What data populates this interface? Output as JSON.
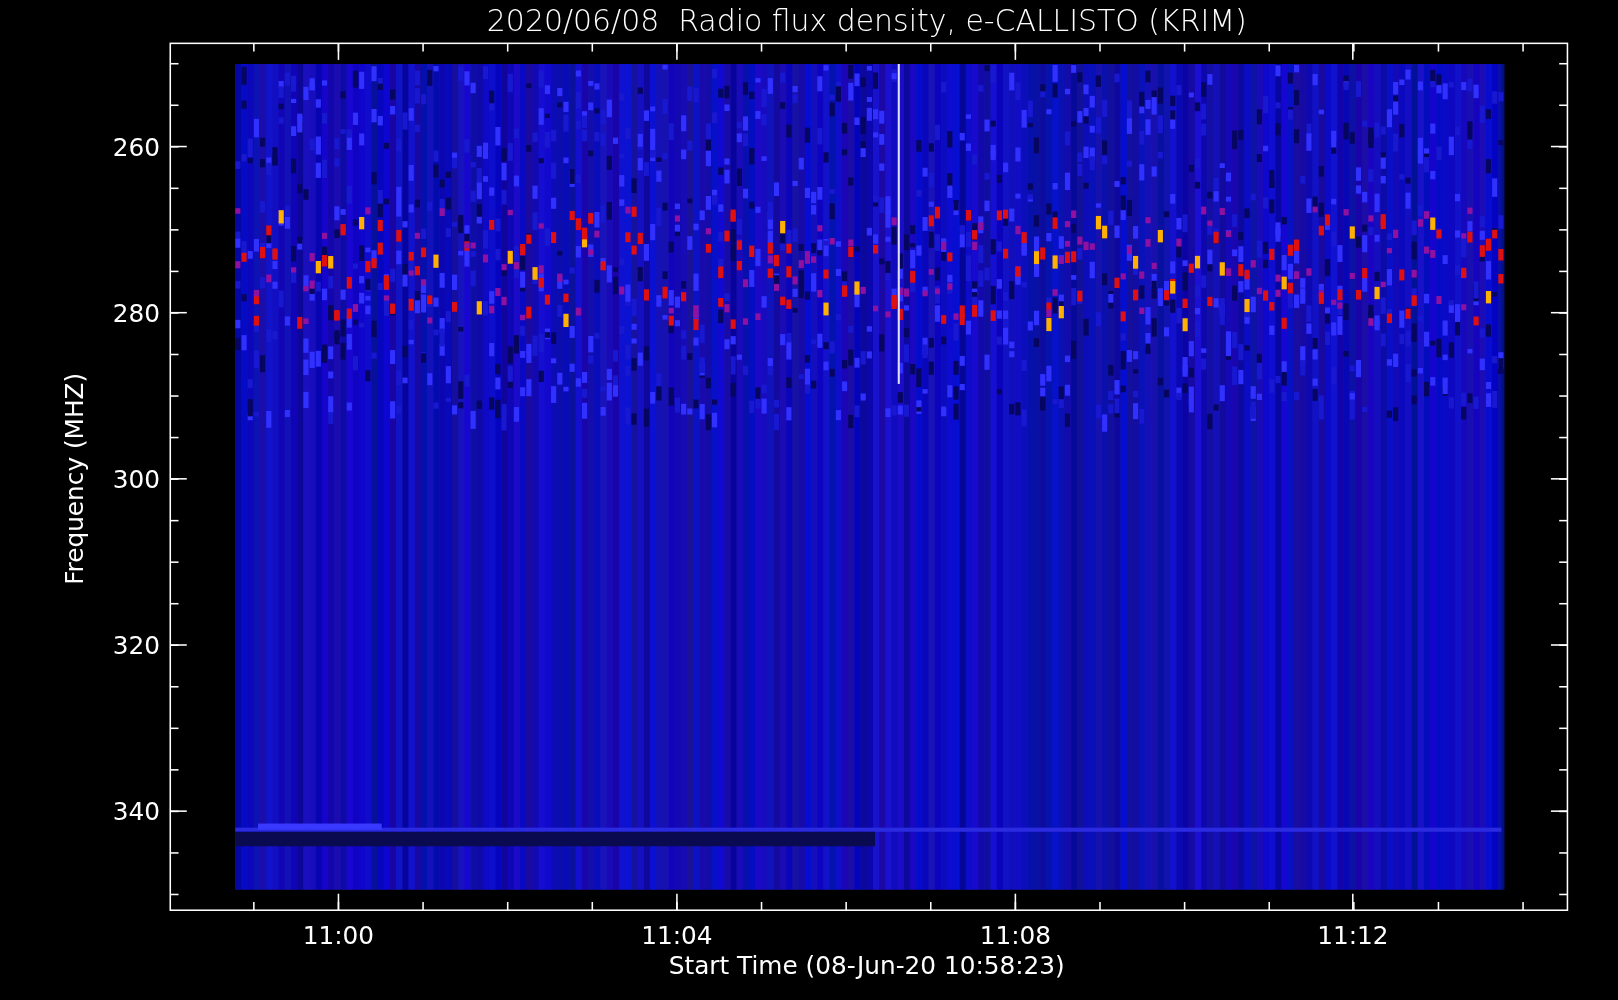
{
  "title": "2020/06/08  Radio flux density, e-CALLISTO (KRIM)",
  "plot": {
    "ylabel": "Frequency (MHZ)",
    "xlabel": "Start Time (08-Jun-20 10:58:23)",
    "y_tick_labels": [
      "260",
      "280",
      "300",
      "320",
      "340"
    ],
    "x_tick_labels": [
      "11:00",
      "11:04",
      "11:08",
      "11:12"
    ]
  }
}
